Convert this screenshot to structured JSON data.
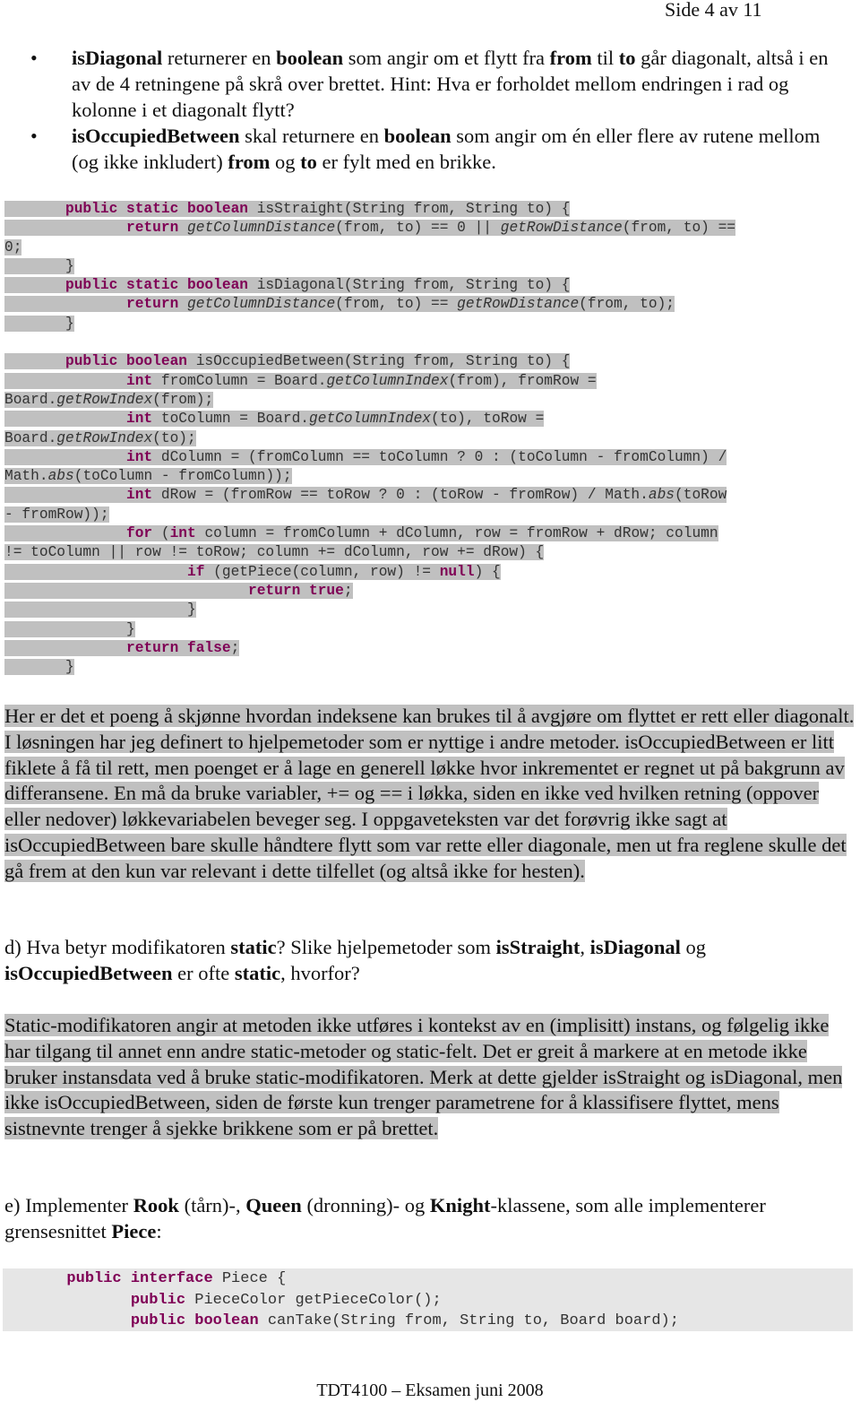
{
  "header": {
    "page_number": "Side 4 av 11"
  },
  "bullets": [
    {
      "parts": [
        {
          "b": "isDiagonal"
        },
        {
          "t": " returnerer en "
        },
        {
          "b": "boolean"
        },
        {
          "t": " som angir om et flytt fra "
        },
        {
          "b": "from"
        },
        {
          "t": " til "
        },
        {
          "b": "to"
        },
        {
          "t": " går diagonalt, altså i en av de 4 retningene på skrå over brettet. Hint: Hva er forholdet mellom endringen i rad og kolonne i et diagonalt flytt?"
        }
      ]
    },
    {
      "parts": [
        {
          "b": "isOccupiedBetween"
        },
        {
          "t": " skal returnere en "
        },
        {
          "b": "boolean"
        },
        {
          "t": " som angir om én eller flere av rutene mellom (og ikke inkludert) "
        },
        {
          "b": "from"
        },
        {
          "t": " og "
        },
        {
          "b": "to"
        },
        {
          "t": " er fylt med en brikke."
        }
      ]
    }
  ],
  "code_block_1": [
    [
      [
        "s",
        "       "
      ],
      [
        "k",
        "public static boolean"
      ],
      [
        "s",
        " isStraight(String from, String to) {"
      ]
    ],
    [
      [
        "s",
        "              "
      ],
      [
        "k",
        "return"
      ],
      [
        "s",
        " "
      ],
      [
        "i",
        "getColumnDistance"
      ],
      [
        "s",
        "(from, to) == 0 || "
      ],
      [
        "i",
        "getRowDistance"
      ],
      [
        "s",
        "(from, to) =="
      ]
    ],
    [
      [
        "s",
        "0;"
      ]
    ],
    [
      [
        "s",
        "       }"
      ]
    ],
    [
      [
        "s",
        "       "
      ],
      [
        "k",
        "public static boolean"
      ],
      [
        "s",
        " isDiagonal(String from, String to) {"
      ]
    ],
    [
      [
        "s",
        "              "
      ],
      [
        "k",
        "return"
      ],
      [
        "s",
        " "
      ],
      [
        "i",
        "getColumnDistance"
      ],
      [
        "s",
        "(from, to) == "
      ],
      [
        "i",
        "getRowDistance"
      ],
      [
        "s",
        "(from, to);"
      ]
    ],
    [
      [
        "s",
        "       }"
      ]
    ],
    [
      [
        "s",
        ""
      ]
    ],
    [
      [
        "s",
        "       "
      ],
      [
        "k",
        "public boolean"
      ],
      [
        "s",
        " isOccupiedBetween(String from, String to) {"
      ]
    ],
    [
      [
        "s",
        "              "
      ],
      [
        "k",
        "int"
      ],
      [
        "s",
        " fromColumn = Board."
      ],
      [
        "i",
        "getColumnIndex"
      ],
      [
        "s",
        "(from), fromRow ="
      ]
    ],
    [
      [
        "s",
        "Board."
      ],
      [
        "i",
        "getRowIndex"
      ],
      [
        "s",
        "(from);"
      ]
    ],
    [
      [
        "s",
        "              "
      ],
      [
        "k",
        "int"
      ],
      [
        "s",
        " toColumn = Board."
      ],
      [
        "i",
        "getColumnIndex"
      ],
      [
        "s",
        "(to), toRow ="
      ]
    ],
    [
      [
        "s",
        "Board."
      ],
      [
        "i",
        "getRowIndex"
      ],
      [
        "s",
        "(to);"
      ]
    ],
    [
      [
        "s",
        "              "
      ],
      [
        "k",
        "int"
      ],
      [
        "s",
        " dColumn = (fromColumn == toColumn ? 0 : (toColumn - fromColumn) /"
      ]
    ],
    [
      [
        "s",
        "Math."
      ],
      [
        "i",
        "abs"
      ],
      [
        "s",
        "(toColumn - fromColumn));"
      ]
    ],
    [
      [
        "s",
        "              "
      ],
      [
        "k",
        "int"
      ],
      [
        "s",
        " dRow = (fromRow == toRow ? 0 : (toRow - fromRow) / Math."
      ],
      [
        "i",
        "abs"
      ],
      [
        "s",
        "(toRow"
      ]
    ],
    [
      [
        "s",
        "- fromRow));"
      ]
    ],
    [
      [
        "s",
        "              "
      ],
      [
        "k",
        "for"
      ],
      [
        "s",
        " ("
      ],
      [
        "k",
        "int"
      ],
      [
        "s",
        " column = fromColumn + dColumn, row = fromRow + dRow; column"
      ]
    ],
    [
      [
        "s",
        "!= toColumn || row != toRow; column += dColumn, row += dRow) {"
      ]
    ],
    [
      [
        "s",
        "                     "
      ],
      [
        "k",
        "if"
      ],
      [
        "s",
        " (getPiece(column, row) != "
      ],
      [
        "k",
        "null"
      ],
      [
        "s",
        ") {"
      ]
    ],
    [
      [
        "s",
        "                            "
      ],
      [
        "k",
        "return true"
      ],
      [
        "s",
        ";"
      ]
    ],
    [
      [
        "s",
        "                     }"
      ]
    ],
    [
      [
        "s",
        "              }"
      ]
    ],
    [
      [
        "s",
        "              "
      ],
      [
        "k",
        "return false"
      ],
      [
        "s",
        ";"
      ]
    ],
    [
      [
        "s",
        "       }"
      ]
    ]
  ],
  "answer_c": "Her er det et poeng å skjønne hvordan indeksene kan brukes til å avgjøre om flyttet er rett eller diagonalt. I løsningen har jeg definert to hjelpemetoder som er nyttige i andre metoder. isOccupiedBetween er litt fiklete å få til rett, men poenget er å lage en generell løkke hvor inkrementet er regnet ut på bakgrunn av differansene. En må da bruke variabler, += og == i løkka, siden en ikke ved hvilken retning (oppover eller nedover) løkkevariabelen beveger seg. I oppgaveteksten var det forøvrig ikke sagt at isOccupiedBetween bare skulle håndtere flytt som var rette eller diagonale, men ut fra reglene skulle det gå frem at den kun var relevant i dette tilfellet (og altså ikke for hesten).",
  "question_d": [
    {
      "t": "d) Hva betyr modifikatoren "
    },
    {
      "b": "static"
    },
    {
      "t": "? Slike hjelpemetoder som "
    },
    {
      "b": "isStraight"
    },
    {
      "t": ", "
    },
    {
      "b": "isDiagonal"
    },
    {
      "t": " og "
    },
    {
      "b": "isOccupiedBetween"
    },
    {
      "t": " er ofte "
    },
    {
      "b": "static"
    },
    {
      "t": ", hvorfor?"
    }
  ],
  "answer_d": "Static-modifikatoren angir at metoden ikke utføres i kontekst av en (implisitt) instans, og følgelig ikke har tilgang til annet enn andre static-metoder og static-felt. Det er greit å markere at en metode ikke bruker instansdata ved å bruke static-modifikatoren. Merk at dette gjelder isStraight og isDiagonal, men ikke isOccupiedBetween, siden de første kun trenger parametrene for å klassifisere flyttet, mens sistnevnte trenger å sjekke brikkene som er på brettet.",
  "question_e": [
    {
      "t": "e) Implementer "
    },
    {
      "b": "Rook"
    },
    {
      "t": " (tårn)-, "
    },
    {
      "b": "Queen"
    },
    {
      "t": " (dronning)- og "
    },
    {
      "b": "Knight"
    },
    {
      "t": "-klassene, som alle implementerer grensesnittet "
    },
    {
      "b": "Piece"
    },
    {
      "t": ":"
    }
  ],
  "code_block_2": [
    [
      [
        "s",
        "       "
      ],
      [
        "k",
        "public interface"
      ],
      [
        "s",
        " Piece {"
      ]
    ],
    [
      [
        "s",
        "              "
      ],
      [
        "k",
        "public"
      ],
      [
        "s",
        " PieceColor getPieceColor();"
      ]
    ],
    [
      [
        "s",
        "              "
      ],
      [
        "k",
        "public boolean"
      ],
      [
        "s",
        " canTake(String from, String to, Board board);"
      ]
    ]
  ],
  "footer": {
    "text": "TDT4100 – Eksamen juni 2008"
  },
  "colors": {
    "keyword": "#7f0055",
    "highlight": "#c0c0c0",
    "code_bg": "#e6e6e6"
  }
}
